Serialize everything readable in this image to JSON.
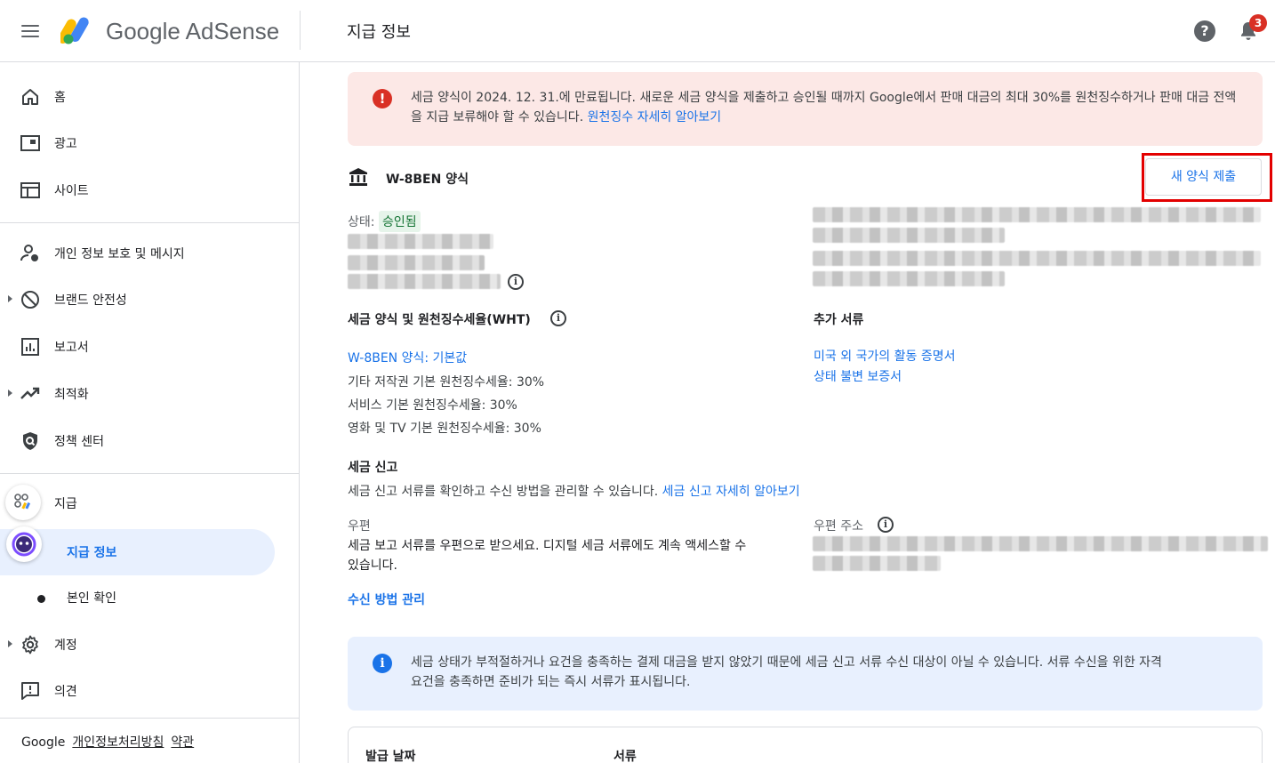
{
  "header": {
    "brand": "Google AdSense",
    "page_title": "지급 정보",
    "notification_count": "3",
    "help_icon": "help-circle-icon",
    "bell_icon": "bell-icon",
    "menu_icon": "hamburger-menu-icon"
  },
  "sidebar": {
    "items": [
      {
        "label": "홈",
        "icon": "home-icon"
      },
      {
        "label": "광고",
        "icon": "ads-icon"
      },
      {
        "label": "사이트",
        "icon": "sites-icon"
      },
      {
        "label": "개인 정보 보호 및 메시지",
        "icon": "privacy-messaging-icon"
      },
      {
        "label": "브랜드 안전성",
        "icon": "block-icon"
      },
      {
        "label": "보고서",
        "icon": "reports-icon"
      },
      {
        "label": "최적화",
        "icon": "trending-icon"
      },
      {
        "label": "정책 센터",
        "icon": "policy-shield-icon"
      },
      {
        "label": "지급",
        "icon": "payments-icon"
      },
      {
        "label": "지급 정보"
      },
      {
        "label": "본인 확인"
      },
      {
        "label": "계정",
        "icon": "gear-icon"
      },
      {
        "label": "의견",
        "icon": "feedback-icon"
      }
    ],
    "footer": {
      "google": "Google",
      "privacy": "개인정보처리방침",
      "terms": "약관"
    }
  },
  "alert_warning": {
    "text": "세금 양식이 2024. 12. 31.에 만료됩니다. 새로운 세금 양식을 제출하고 승인될 때까지 Google에서 판매 대금의 최대 30%를 원천징수하거나 판매 대금 전액을 지급 보류해야 할 수 있습니다.",
    "link": "원천징수 자세히 알아보기"
  },
  "form": {
    "title": "W-8BEN 양식",
    "new_form_button": "새 양식 제출",
    "status_label": "상태:",
    "status_value": "승인됨"
  },
  "wht": {
    "heading": "세금 양식 및 원천징수세율(WHT)",
    "default_link": "W-8BEN 양식: 기본값",
    "rates": [
      "기타 저작권 기본 원천징수세율: 30%",
      "서비스 기본 원천징수세율: 30%",
      "영화 및 TV 기본 원천징수세율: 30%"
    ]
  },
  "additional_docs": {
    "heading": "추가 서류",
    "links": [
      "미국 외 국가의 활동 증명서",
      "상태 불변 보증서"
    ]
  },
  "tax_reporting": {
    "heading": "세금 신고",
    "description": "세금 신고 서류를 확인하고 수신 방법을 관리할 수 있습니다.",
    "link": "세금 신고 자세히 알아보기",
    "mail_label": "우편",
    "mail_text_line1": "세금 보고 서류를 우편으로 받으세요. 디지털 세금 서류에도 계속 액세스할 수",
    "mail_text_line2": "있습니다.",
    "mail_address_label": "우편 주소",
    "manage_link": "수신 방법 관리"
  },
  "alert_info": {
    "line1": "세금 상태가 부적절하거나 요건을 충족하는 결제 대금을 받지 않았기 때문에 세금 신고 서류 수신 대상이 아닐 수 있습니다. 서류 수신을 위한 자격",
    "line2": "요건을 충족하면 준비가 되는 즉시 서류가 표시됩니다."
  },
  "table": {
    "columns": [
      "발급 날짜",
      "서류"
    ]
  },
  "colors": {
    "accent": "#1a73e8",
    "warning_bg": "#fce8e6",
    "error": "#d93025",
    "success": "#137333",
    "info_bg": "#e8f0fe",
    "highlight_box": "#e30000"
  }
}
